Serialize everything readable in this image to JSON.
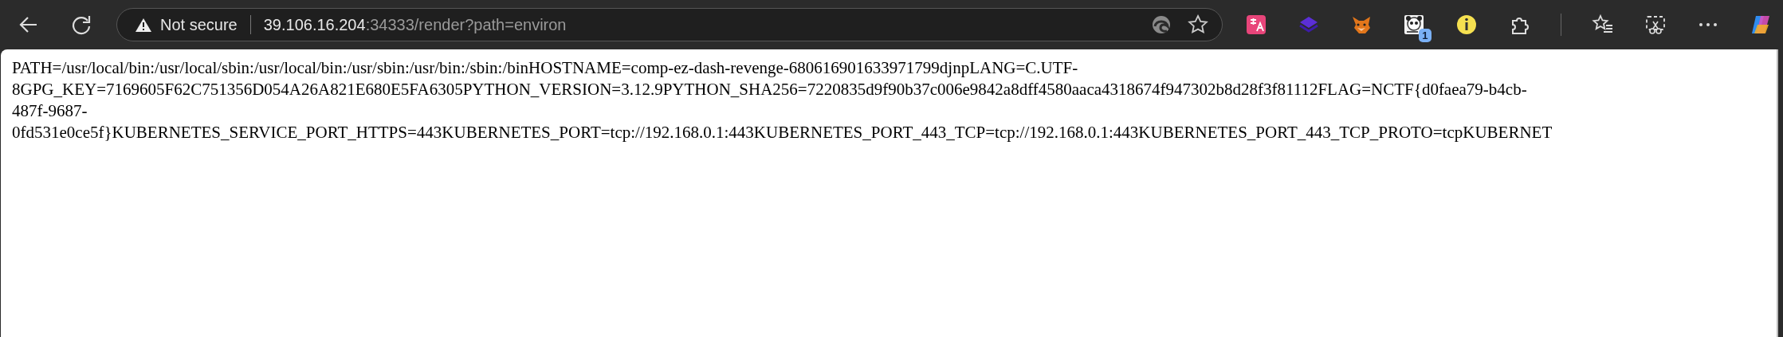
{
  "address_bar": {
    "security_label": "Not secure",
    "host": "39.106.16.204",
    "path": ":34333/render?path=environ"
  },
  "extension_badge": "1",
  "page_lines": [
    "PATH=/usr/local/bin:/usr/local/sbin:/usr/local/bin:/usr/sbin:/usr/bin:/sbin:/binHOSTNAME=comp-ez-dash-revenge-680616901633971799djnpLANG=C.UTF-",
    "8GPG_KEY=7169605F62C751356D054A26A821E680E5FA6305PYTHON_VERSION=3.12.9PYTHON_SHA256=7220835d9f90b37c006e9842a8dff4580aaca4318674f947302b8d28f3f81112FLAG=NCTF{d0faea79-b4cb-",
    "487f-9687-",
    "0fd531e0ce5f}KUBERNETES_SERVICE_PORT_HTTPS=443KUBERNETES_PORT=tcp://192.168.0.1:443KUBERNETES_PORT_443_TCP=tcp://192.168.0.1:443KUBERNETES_PORT_443_TCP_PROTO=tcpKUBERNET"
  ]
}
